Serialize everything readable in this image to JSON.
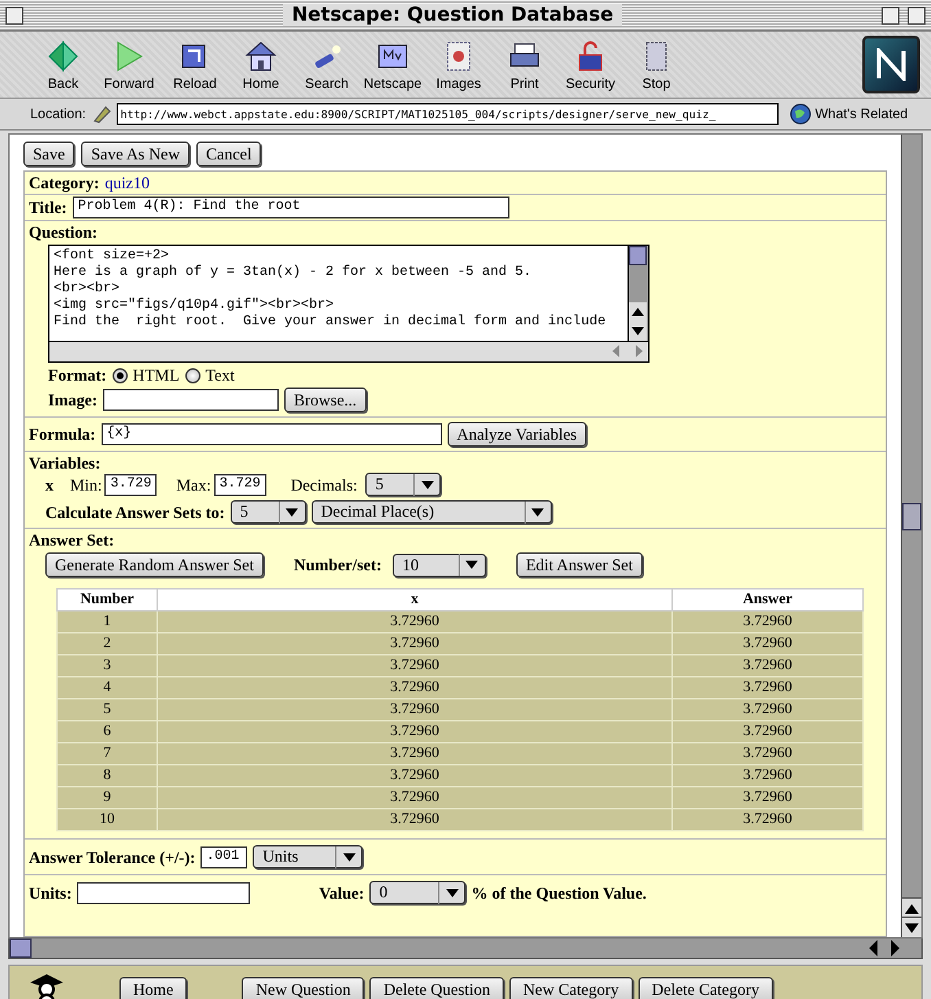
{
  "window": {
    "title": "Netscape: Question Database"
  },
  "toolbar": [
    {
      "label": "Back"
    },
    {
      "label": "Forward"
    },
    {
      "label": "Reload"
    },
    {
      "label": "Home"
    },
    {
      "label": "Search"
    },
    {
      "label": "Netscape"
    },
    {
      "label": "Images"
    },
    {
      "label": "Print"
    },
    {
      "label": "Security"
    },
    {
      "label": "Stop"
    }
  ],
  "location": {
    "label": "Location:",
    "url": "http://www.webct.appstate.edu:8900/SCRIPT/MAT1025105_004/scripts/designer/serve_new_quiz_",
    "related": "What's Related"
  },
  "buttons": [
    "Save",
    "Save As New",
    "Cancel"
  ],
  "category": {
    "label": "Category:",
    "value": "quiz10"
  },
  "title_field": {
    "label": "Title:",
    "value": "Problem 4(R):  Find the root"
  },
  "question": {
    "label": "Question:",
    "lines": [
      "<font size=+2>",
      "Here is a graph of y = 3tan(x) - 2 for x between -5 and 5.",
      "<br><br>",
      "<img src=\"figs/q10p4.gif\"><br><br>",
      "Find the  right root.  Give your answer in decimal form and include"
    ]
  },
  "format": {
    "label": "Format:",
    "options": [
      {
        "label": "HTML",
        "selected": true
      },
      {
        "label": "Text",
        "selected": false
      }
    ]
  },
  "image": {
    "label": "Image:",
    "button": "Browse..."
  },
  "formula": {
    "label": "Formula:",
    "value": "{x}",
    "button": "Analyze Variables"
  },
  "variables": {
    "label": "Variables:",
    "name": "x",
    "min_label": "Min:",
    "min": "3.729",
    "max_label": "Max:",
    "max": "3.729",
    "decimals_label": "Decimals:",
    "decimals": "5",
    "calc_label": "Calculate Answer Sets to:",
    "calc_value": "5",
    "calc_unit": "Decimal Place(s)"
  },
  "answer_set": {
    "label": "Answer Set:",
    "generate_button": "Generate Random Answer Set",
    "number_label": "Number/set:",
    "number_value": "10",
    "edit_button": "Edit Answer Set",
    "table": {
      "columns": [
        "Number",
        "x",
        "Answer"
      ],
      "rows": [
        [
          "1",
          "3.72960",
          "3.72960"
        ],
        [
          "2",
          "3.72960",
          "3.72960"
        ],
        [
          "3",
          "3.72960",
          "3.72960"
        ],
        [
          "4",
          "3.72960",
          "3.72960"
        ],
        [
          "5",
          "3.72960",
          "3.72960"
        ],
        [
          "6",
          "3.72960",
          "3.72960"
        ],
        [
          "7",
          "3.72960",
          "3.72960"
        ],
        [
          "8",
          "3.72960",
          "3.72960"
        ],
        [
          "9",
          "3.72960",
          "3.72960"
        ],
        [
          "10",
          "3.72960",
          "3.72960"
        ]
      ]
    }
  },
  "tolerance": {
    "label": "Answer Tolerance (+/-):",
    "value": ".001",
    "unit": "Units"
  },
  "units": {
    "label": "Units:",
    "value_label": "Value:",
    "value": "0",
    "suffix": "% of the Question Value."
  },
  "bottom_buttons": [
    "Home",
    "New Question",
    "Delete Question",
    "New Category",
    "Delete Category"
  ]
}
